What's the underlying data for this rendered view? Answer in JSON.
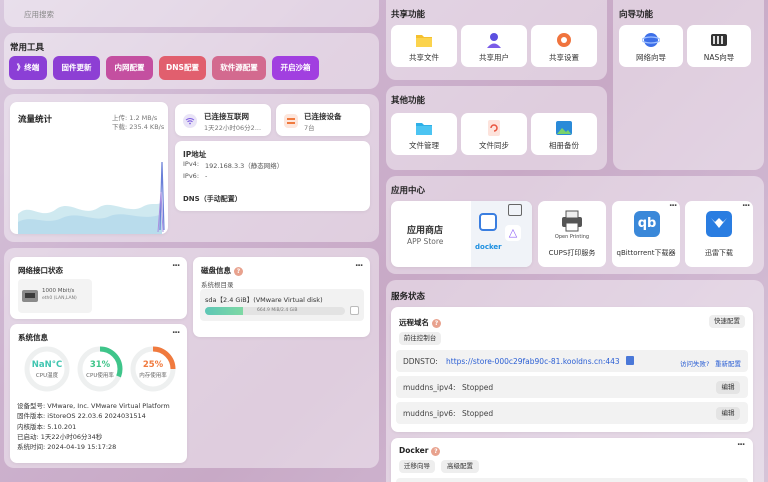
{
  "search": {
    "placeholder": "应用搜索"
  },
  "tools": {
    "title": "常用工具",
    "items": [
      {
        "label": "》终端",
        "color": "#8b3fd6"
      },
      {
        "label": "固件更新",
        "color": "#8d3fd4"
      },
      {
        "label": "内网配置",
        "color": "#c44fa0"
      },
      {
        "label": "DNS配置",
        "color": "#e15f6e"
      },
      {
        "label": "软件源配置",
        "color": "#d36a8f"
      },
      {
        "label": "开启沙箱",
        "color": "#a13fe0"
      }
    ]
  },
  "traffic": {
    "title": "流量统计",
    "upload": "上传: 1.2 MB/s",
    "download": "下载: 235.4 KB/s"
  },
  "internet": {
    "title": "已连接互联网",
    "sub": "1天22小时06分2..."
  },
  "devices": {
    "title": "已连接设备",
    "count": "7台"
  },
  "ip": {
    "title": "IP地址",
    "ipv4_label": "IPv4:",
    "ipv4_value": "192.168.3.3（静态网络）",
    "ipv6_label": "IPv6:",
    "ipv6_value": "-",
    "dns": "DNS（手动配置）"
  },
  "network": {
    "title": "网络接口状态",
    "more": "...",
    "port_speed": "1000 Mbit/s",
    "port_name": "eth0 (LAN,LAN)"
  },
  "sysinfo": {
    "title": "系统信息",
    "more": "...",
    "gauges": [
      {
        "value": "NaN°C",
        "label": "CPU温度",
        "percent": 0,
        "color": "#3fc5b0"
      },
      {
        "value": "31%",
        "label": "CPU使用率",
        "percent": 31,
        "color": "#3fc58a"
      },
      {
        "value": "25%",
        "label": "内存使用率",
        "percent": 25,
        "color": "#f07a3e"
      }
    ],
    "rows": [
      {
        "k": "设备型号:",
        "v": "VMware, Inc. VMware Virtual Platform"
      },
      {
        "k": "固件版本:",
        "v": "iStoreOS 22.03.6 2024031514"
      },
      {
        "k": "内核版本:",
        "v": "5.10.201"
      },
      {
        "k": "已启动:",
        "v": "1天22小时06分34秒"
      },
      {
        "k": "系统时间:",
        "v": "2024-04-19 15:17:28"
      }
    ]
  },
  "disk": {
    "title": "磁盘信息",
    "q": "?",
    "more": "...",
    "sys_label": "系统根目录",
    "name": "sda【2.4 GiB】(VMware Virtual disk)",
    "usage": "664.9 MiB/2.4 GiB",
    "percent": 27
  },
  "share": {
    "title": "共享功能",
    "items": [
      {
        "label": "共享文件"
      },
      {
        "label": "共享用户"
      },
      {
        "label": "共享设置"
      }
    ]
  },
  "wizard": {
    "title": "向导功能",
    "items": [
      {
        "label": "网络向导"
      },
      {
        "label": "NAS向导"
      }
    ]
  },
  "other": {
    "title": "其他功能",
    "items": [
      {
        "label": "文件管理"
      },
      {
        "label": "文件同步"
      },
      {
        "label": "相册备份"
      }
    ]
  },
  "appcenter": {
    "title": "应用中心",
    "store_title": "应用商店",
    "store_sub": "APP Store",
    "docker_label": "docker",
    "cups_brand": "Open Printing",
    "apps": [
      {
        "label": "CUPS打印服务"
      },
      {
        "label": "qBittorrent下载器"
      },
      {
        "label": "迅雷下载"
      }
    ],
    "more": "..."
  },
  "service": {
    "title": "服务状态",
    "remote": {
      "title": "远程域名",
      "q": "?",
      "quick": "快速配置",
      "console": "前往控制台",
      "ddnsto_label": "DDNSTO:",
      "ddnsto_url": "https://store-000c29fab90c-81.kooldns.cn:443",
      "fail": "访问失败?",
      "reconfig": "重新配置",
      "rows": [
        {
          "name": "muddns_ipv4:",
          "status": "Stopped",
          "btn": "编辑"
        },
        {
          "name": "muddns_ipv6:",
          "status": "Stopped",
          "btn": "编辑"
        }
      ]
    },
    "docker": {
      "title": "Docker",
      "q": "?",
      "more": "...",
      "btn1": "迁移向导",
      "btn2": "高级配置"
    }
  }
}
